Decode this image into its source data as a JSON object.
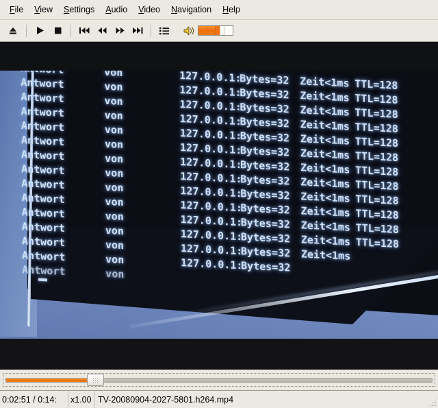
{
  "window": {
    "background_color": "#ece9e3"
  },
  "menubar": {
    "items": [
      {
        "label": "File",
        "mnemonic": "F",
        "rest": "ile"
      },
      {
        "label": "View",
        "mnemonic": "V",
        "rest": "iew"
      },
      {
        "label": "Settings",
        "mnemonic": "S",
        "rest": "ettings"
      },
      {
        "label": "Audio",
        "mnemonic": "A",
        "rest": "udio"
      },
      {
        "label": "Video",
        "mnemonic": "V",
        "rest": "ideo"
      },
      {
        "label": "Navigation",
        "mnemonic": "N",
        "rest": "avigation"
      },
      {
        "label": "Help",
        "mnemonic": "H",
        "rest": "elp"
      }
    ]
  },
  "toolbar": {
    "buttons": [
      {
        "name": "eject-button",
        "icon": "eject-icon",
        "glyph": "⏏"
      },
      {
        "name": "play-button",
        "icon": "play-icon",
        "glyph": "▶"
      },
      {
        "name": "stop-button",
        "icon": "stop-icon",
        "glyph": "■"
      },
      {
        "name": "skip-backward-button",
        "icon": "skip-backward-icon",
        "glyph": "⏮"
      },
      {
        "name": "rewind-button",
        "icon": "rewind-icon",
        "glyph": "⏪"
      },
      {
        "name": "fast-forward-button",
        "icon": "fast-forward-icon",
        "glyph": "⏩"
      },
      {
        "name": "skip-forward-button",
        "icon": "skip-forward-icon",
        "glyph": "⏭"
      },
      {
        "name": "playlist-button",
        "icon": "playlist-icon",
        "glyph": "☰"
      }
    ],
    "volume": {
      "icon": "speaker-icon",
      "segments": 4,
      "filled": 2,
      "partial": 1,
      "fill_color": "#ef6c0b",
      "icon_color": "#e8c23a"
    }
  },
  "video": {
    "letterbox_color": "#101113",
    "console_text": {
      "col_reply": "Antwort",
      "col_from": "von",
      "col_host": "127.0.0.1:",
      "col_bytes": "Bytes=32",
      "col_time": "Zeit<1ms",
      "col_ttl": "TTL=128",
      "full_line": "Antwort von 127.0.0.1: Bytes=32 Zeit<1ms TTL=128",
      "line_count": 15,
      "glow_color": "#cfe0f5"
    },
    "scene": {
      "desk_color": "#6c88bc",
      "screen_color": "#0c0e16",
      "edge_highlight": "#e8f0fb"
    }
  },
  "seekbar": {
    "name": "seek-slider",
    "position_percent": 19.6,
    "fill_color": "#ee6d0a",
    "track_color": "#c2bfb7"
  },
  "statusbar": {
    "time": "0:02:51 / 0:14:",
    "rate": "x1.00",
    "filename": "TV-20080904-2027-5801.h264.mp4"
  }
}
